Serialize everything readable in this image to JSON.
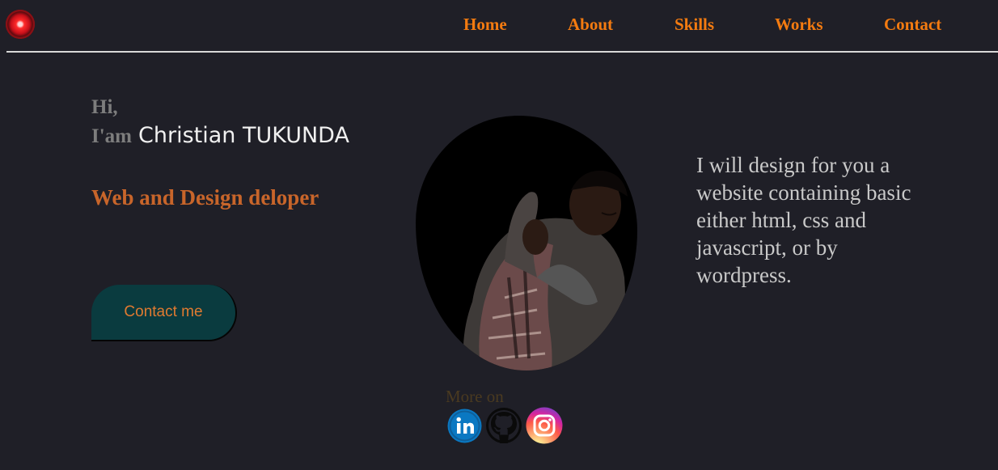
{
  "header": {
    "logo_icon": "logo-icon",
    "nav": [
      {
        "label": "Home"
      },
      {
        "label": "About"
      },
      {
        "label": "Skills"
      },
      {
        "label": "Works"
      },
      {
        "label": "Contact"
      }
    ]
  },
  "intro": {
    "greeting": "Hi,",
    "iam": "I'am",
    "name": "Christian TUKUNDA",
    "role": "Web and Design deloper",
    "contact_button": "Contact me"
  },
  "portrait": {
    "icon": "profile-photo"
  },
  "description": "I will design for you a website containing basic either html, css and javascript, or by wordpress.",
  "social": {
    "label": "More on",
    "links": [
      {
        "icon": "linkedin-icon",
        "color": "#0a66c2"
      },
      {
        "icon": "github-icon",
        "color": "#000000"
      },
      {
        "icon": "instagram-icon",
        "color": "#d6249f"
      }
    ]
  },
  "colors": {
    "background": "#1f1f27",
    "accent": "#f47b10",
    "role": "#c8652a",
    "button": "#0a3b3f"
  }
}
